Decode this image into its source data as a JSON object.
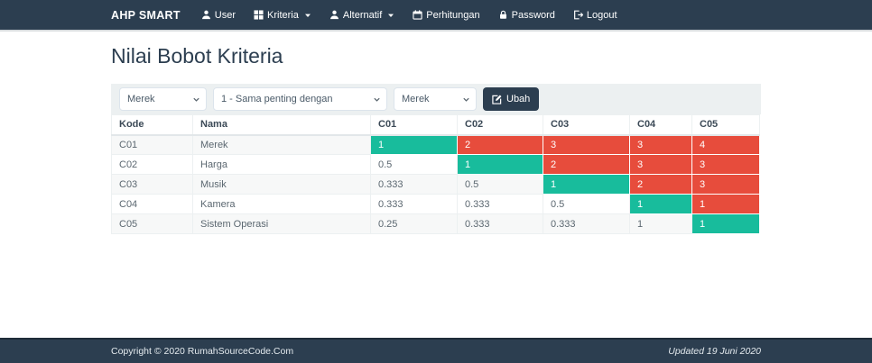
{
  "navbar": {
    "brand": "AHP SMART",
    "items": [
      {
        "label": "User",
        "icon": "user-icon",
        "caret": false
      },
      {
        "label": "Kriteria",
        "icon": "grid-icon",
        "caret": true
      },
      {
        "label": "Alternatif",
        "icon": "user-icon",
        "caret": true
      },
      {
        "label": "Perhitungan",
        "icon": "calendar-icon",
        "caret": false
      },
      {
        "label": "Password",
        "icon": "lock-icon",
        "caret": false
      },
      {
        "label": "Logout",
        "icon": "logout-icon",
        "caret": false
      }
    ]
  },
  "page": {
    "title": "Nilai Bobot Kriteria"
  },
  "form": {
    "kriteria1_selected": "Merek",
    "nilai_selected": "1 - Sama penting dengan",
    "kriteria2_selected": "Merek",
    "submit_label": "Ubah",
    "submit_icon": "edit-icon"
  },
  "table": {
    "headers": [
      "Kode",
      "Nama",
      "C01",
      "C02",
      "C03",
      "C04",
      "C05"
    ],
    "rows": [
      {
        "kode": "C01",
        "nama": "Merek",
        "values": [
          {
            "v": "1",
            "bg": "green"
          },
          {
            "v": "2",
            "bg": "red"
          },
          {
            "v": "3",
            "bg": "red"
          },
          {
            "v": "3",
            "bg": "red"
          },
          {
            "v": "4",
            "bg": "red"
          }
        ]
      },
      {
        "kode": "C02",
        "nama": "Harga",
        "values": [
          {
            "v": "0.5",
            "bg": "none"
          },
          {
            "v": "1",
            "bg": "green"
          },
          {
            "v": "2",
            "bg": "red"
          },
          {
            "v": "3",
            "bg": "red"
          },
          {
            "v": "3",
            "bg": "red"
          }
        ]
      },
      {
        "kode": "C03",
        "nama": "Musik",
        "values": [
          {
            "v": "0.333",
            "bg": "none"
          },
          {
            "v": "0.5",
            "bg": "none"
          },
          {
            "v": "1",
            "bg": "green"
          },
          {
            "v": "2",
            "bg": "red"
          },
          {
            "v": "3",
            "bg": "red"
          }
        ]
      },
      {
        "kode": "C04",
        "nama": "Kamera",
        "values": [
          {
            "v": "0.333",
            "bg": "none"
          },
          {
            "v": "0.333",
            "bg": "none"
          },
          {
            "v": "0.5",
            "bg": "none"
          },
          {
            "v": "1",
            "bg": "green"
          },
          {
            "v": "1",
            "bg": "red"
          }
        ]
      },
      {
        "kode": "C05",
        "nama": "Sistem Operasi",
        "values": [
          {
            "v": "0.25",
            "bg": "none"
          },
          {
            "v": "0.333",
            "bg": "none"
          },
          {
            "v": "0.333",
            "bg": "none"
          },
          {
            "v": "1",
            "bg": "none"
          },
          {
            "v": "1",
            "bg": "green"
          }
        ]
      }
    ]
  },
  "footer": {
    "copyright": "Copyright © 2020 RumahSourceCode.Com",
    "updated": "Updated 19 Juni 2020"
  },
  "colors": {
    "navbar": "#2C3E50",
    "green": "#18BC9C",
    "red": "#E74C3C"
  }
}
